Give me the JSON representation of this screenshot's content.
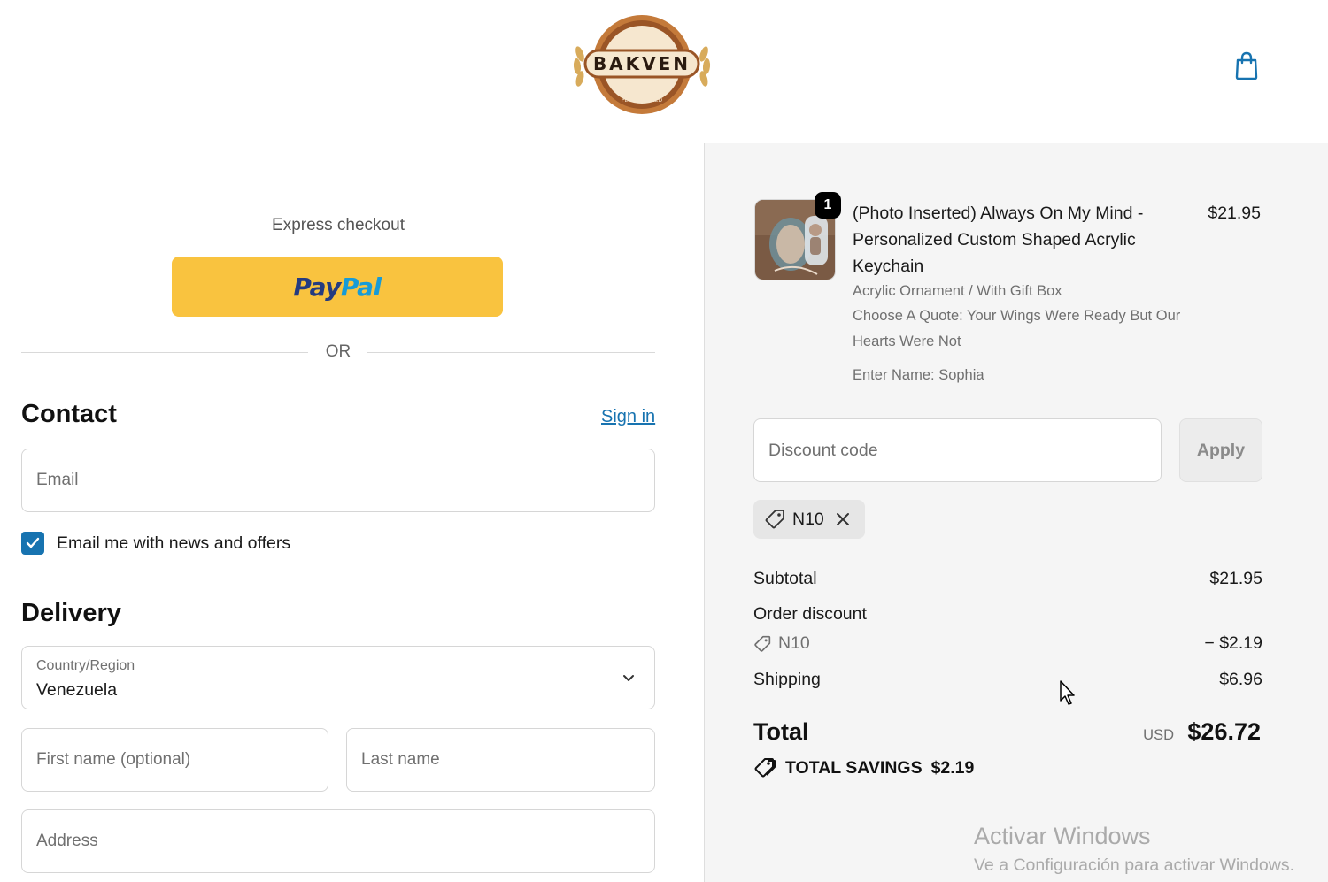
{
  "header": {
    "brand": "BAKVEN",
    "brand_top": "SINCE 2020",
    "brand_bottom": "PERSONALIZED",
    "cart_icon": "shopping-bag-icon"
  },
  "express": {
    "label": "Express checkout",
    "paypal_part1": "Pay",
    "paypal_part2": "Pal",
    "or_text": "OR"
  },
  "contact": {
    "title": "Contact",
    "sign_in": "Sign in",
    "email_placeholder": "Email",
    "newsletter_label": "Email me with news and offers",
    "newsletter_checked": true
  },
  "delivery": {
    "title": "Delivery",
    "country_label": "Country/Region",
    "country_value": "Venezuela",
    "first_name_placeholder": "First name (optional)",
    "last_name_placeholder": "Last name",
    "address_placeholder": "Address"
  },
  "summary": {
    "product": {
      "title": "(Photo Inserted) Always On My Mind - Personalized Custom Shaped Acrylic Keychain",
      "price": "$21.95",
      "quantity": "1",
      "variant": "Acrylic Ornament / With Gift Box",
      "quote": "Choose A Quote: Your Wings Were Ready But Our Hearts Were Not",
      "name": "Enter Name: Sophia"
    },
    "discount_placeholder": "Discount code",
    "apply_label": "Apply",
    "applied_code": "N10",
    "subtotal_label": "Subtotal",
    "subtotal_value": "$21.95",
    "order_discount_label": "Order discount",
    "discount_code": "N10",
    "discount_value": "− $2.19",
    "shipping_label": "Shipping",
    "shipping_value": "$6.96",
    "total_label": "Total",
    "total_currency": "USD",
    "total_value": "$26.72",
    "savings_label": "TOTAL SAVINGS",
    "savings_value": "$2.19"
  },
  "watermark": {
    "line1": "Activar Windows",
    "line2": "Ve a Configuración para activar Windows."
  },
  "colors": {
    "paypal_yellow": "#f9c33f",
    "link_blue": "#1773b0",
    "summary_bg": "#f5f5f5"
  }
}
